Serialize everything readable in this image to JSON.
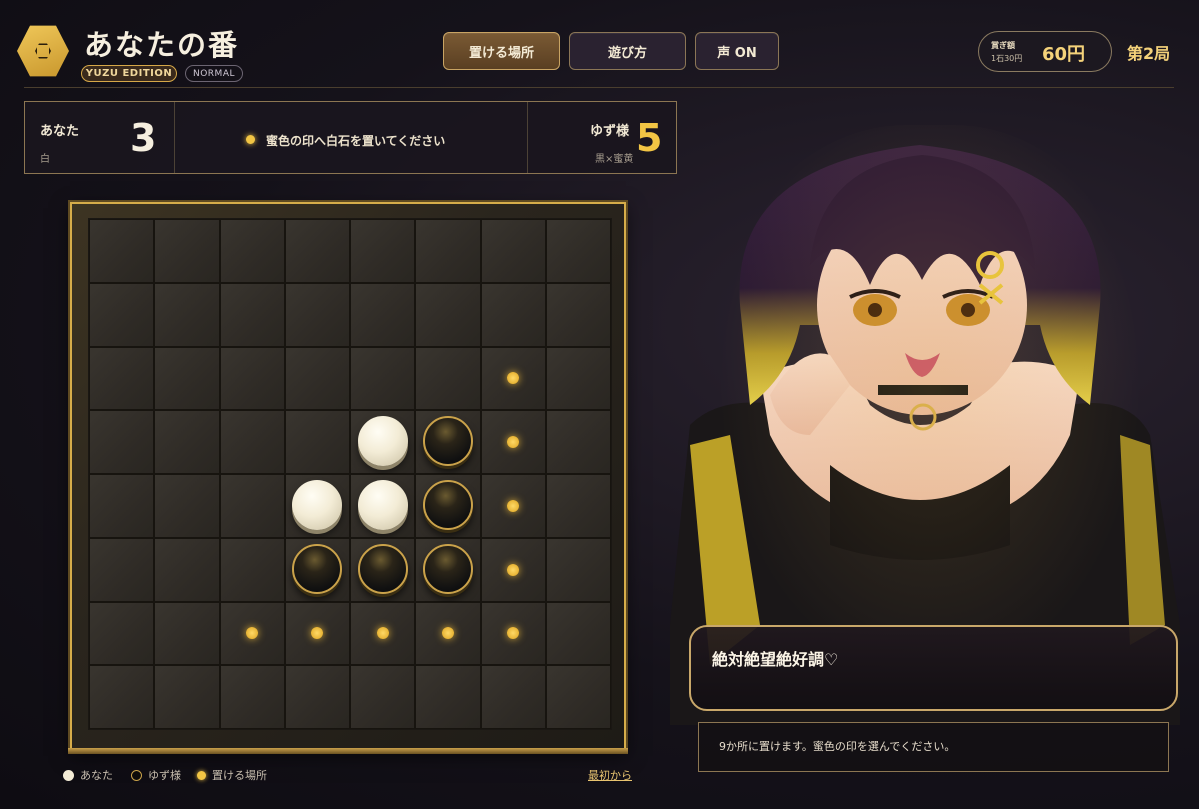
{
  "header": {
    "turn_title": "あなたの番",
    "edition_badge": "YUZU EDITION",
    "mode_badge": "NORMAL",
    "buttons": [
      "置ける場所",
      "遊び方",
      "声 ON"
    ],
    "active_button": "置ける場所",
    "bet": {
      "label": "賞ぎ額",
      "sub": "1石30円",
      "amount": "60円"
    },
    "round": "第2局"
  },
  "score": {
    "player": {
      "name": "あなた",
      "color": "白",
      "count": "3"
    },
    "opponent": {
      "name": "ゆず様",
      "color": "黒×蜜黄",
      "count": "5"
    },
    "message": "蜜色の印へ白石を置いてください"
  },
  "board": {
    "rows": [
      "........",
      "........",
      "......*.",
      "....WB*.",
      "...WWB*.",
      "...BBB*.",
      "..*****.",
      "........"
    ],
    "legend_note": "W = white (あなた), B = black (ゆず様), * = placeable"
  },
  "legend": {
    "you": "あなた",
    "opponent": "ゆず様",
    "placeable": "置ける場所",
    "reset": "最初から"
  },
  "dialogue": {
    "speech": "絶対絶望絶好調♡",
    "status": "9か所に置けます。蜜色の印を選んでください。"
  },
  "colors": {
    "accent_gold": "#d6ad4a",
    "hint_gold": "#f2c544",
    "background": "#15121a"
  }
}
